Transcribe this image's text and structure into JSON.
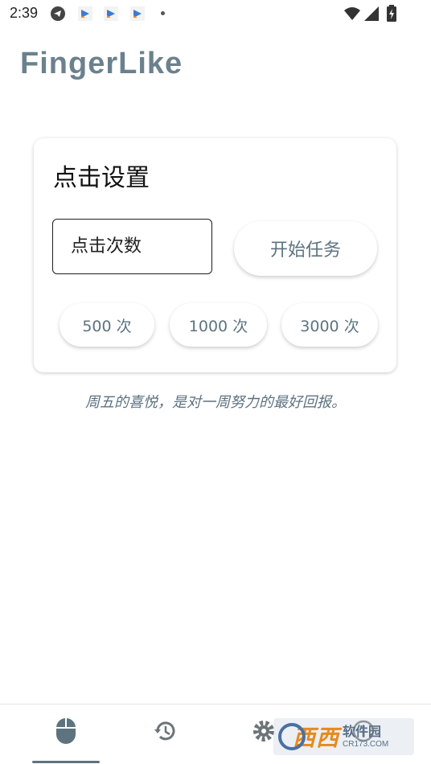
{
  "status_bar": {
    "time": "2:39",
    "icons": [
      "telegram-icon",
      "app-icon",
      "app-icon",
      "app-icon",
      "wifi-icon",
      "signal-icon",
      "battery-charging-icon"
    ]
  },
  "app": {
    "title": "FingerLike",
    "title_color": "#6b818d"
  },
  "card": {
    "title": "点击设置",
    "input_placeholder": "点击次数",
    "start_label": "开始任务",
    "presets": [
      "500 次",
      "1000 次",
      "3000 次"
    ]
  },
  "quote": "周五的喜悦，是对一周努力的最好回报。",
  "bottom_nav": {
    "items": [
      "mouse-icon",
      "history-icon",
      "settings-icon",
      "info-icon"
    ],
    "active_index": 0,
    "accent": "#5d7380"
  },
  "watermark": {
    "main": "西西",
    "cn": "软件园",
    "en": "CR173.COM"
  }
}
